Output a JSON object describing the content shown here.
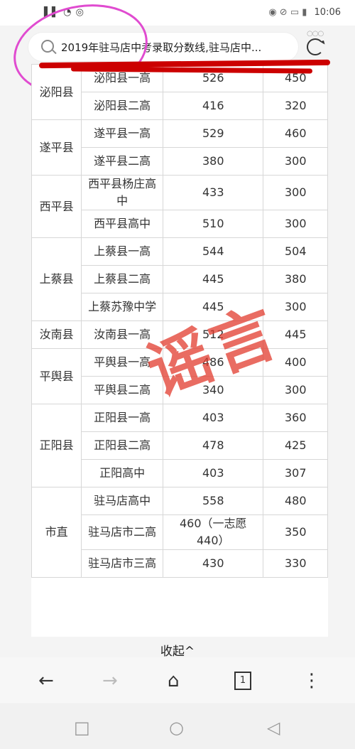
{
  "status_bar": {
    "left": "▌▌ ◔ ◎",
    "right_icons": "◉ ⊘ ▭ ▮",
    "time": "10:06"
  },
  "search": {
    "query": "2019年驻马店中考录取分数线,驻马店中..."
  },
  "table": {
    "rows": [
      {
        "county": "泌阳县",
        "schools": [
          [
            "泌阳县一高",
            "526",
            "450"
          ],
          [
            "泌阳县二高",
            "416",
            "320"
          ]
        ]
      },
      {
        "county": "遂平县",
        "schools": [
          [
            "遂平县一高",
            "529",
            "460"
          ],
          [
            "遂平县二高",
            "380",
            "300"
          ]
        ]
      },
      {
        "county": "西平县",
        "schools": [
          [
            "西平县杨庄高中",
            "433",
            "300"
          ],
          [
            "西平县高中",
            "510",
            "300"
          ]
        ]
      },
      {
        "county": "上蔡县",
        "schools": [
          [
            "上蔡县一高",
            "544",
            "504"
          ],
          [
            "上蔡县二高",
            "445",
            "380"
          ],
          [
            "上蔡苏豫中学",
            "445",
            "300"
          ]
        ]
      },
      {
        "county": "汝南县",
        "schools": [
          [
            "汝南县一高",
            "512",
            "445"
          ]
        ]
      },
      {
        "county": "平舆县",
        "schools": [
          [
            "平舆县一高",
            "486",
            "400"
          ],
          [
            "平舆县二高",
            "340",
            "300"
          ]
        ]
      },
      {
        "county": "正阳县",
        "schools": [
          [
            "正阳县一高",
            "403",
            "360"
          ],
          [
            "正阳县二高",
            "478",
            "425"
          ],
          [
            "正阳高中",
            "403",
            "307"
          ]
        ]
      },
      {
        "county": "市直",
        "schools": [
          [
            "驻马店高中",
            "558",
            "480"
          ],
          [
            "驻马店市二高",
            "460（一志愿440）",
            "350"
          ],
          [
            "驻马店市三高",
            "430",
            "330"
          ]
        ]
      }
    ]
  },
  "stamp": {
    "text": "谣言"
  },
  "collapse_label": "收起^",
  "bottom_nav": {
    "back": "←",
    "forward": "→",
    "home": "⌂",
    "tabs": "1",
    "menu": "⋮"
  },
  "sys_nav": {
    "square": "□",
    "circle": "○",
    "back": "◁"
  }
}
